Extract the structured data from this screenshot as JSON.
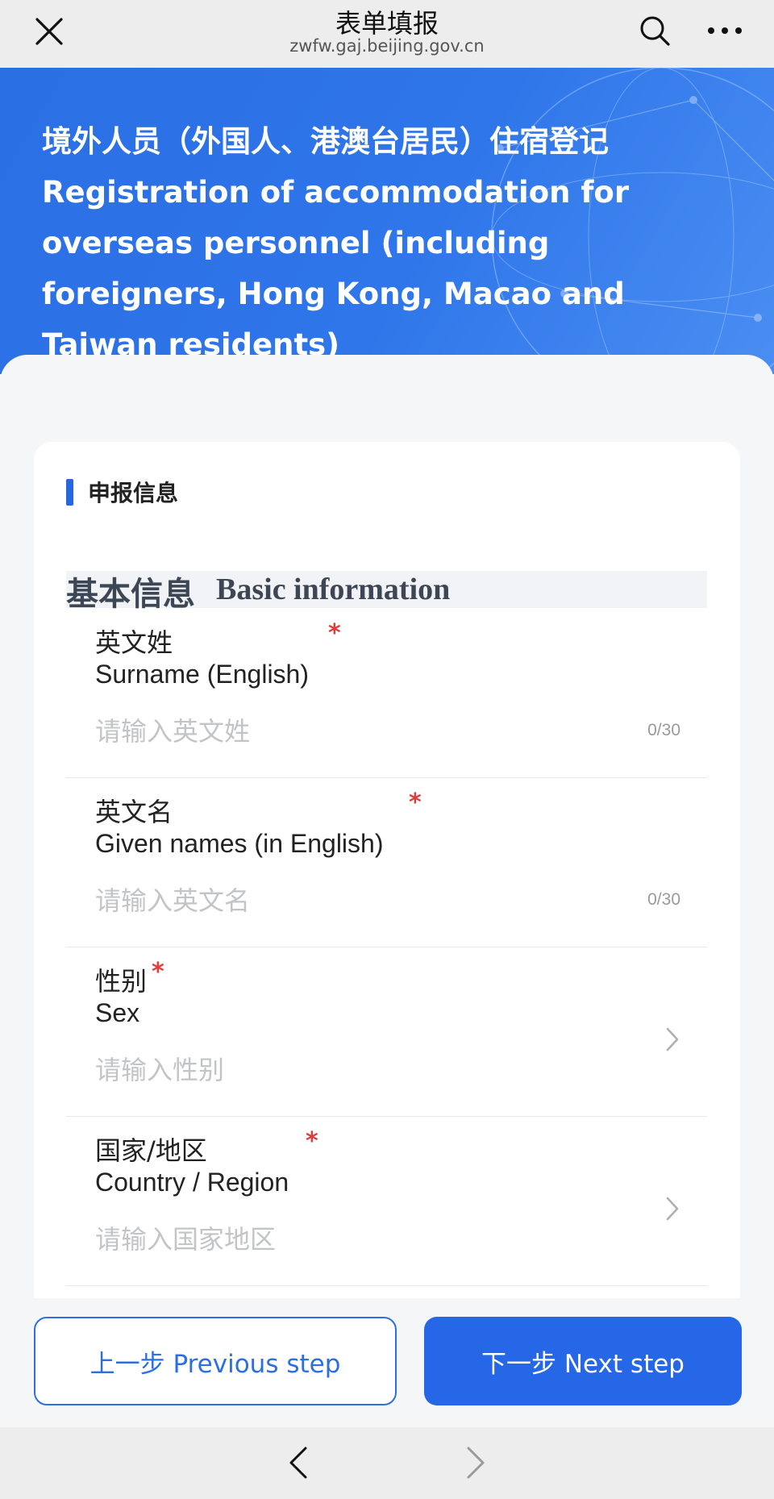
{
  "topbar": {
    "title": "表单填报",
    "url": "zwfw.gaj.beijing.gov.cn"
  },
  "banner": {
    "title": "境外人员（外国人、港澳台居民）住宿登记 Registration of accommodation for overseas personnel (including foreigners, Hong Kong, Macao and Taiwan residents)"
  },
  "section": {
    "title": "申报信息"
  },
  "group": {
    "title_zh": "基本信息",
    "title_en": "Basic information"
  },
  "fields": [
    {
      "label_zh": "英文姓",
      "label_en": "Surname (English)",
      "placeholder": "请输入英文姓",
      "counter": "0/30",
      "required_mark": "*"
    },
    {
      "label_zh": "英文名",
      "label_en": "Given names (in English)",
      "placeholder": "请输入英文名",
      "counter": "0/30",
      "required_mark": "*"
    },
    {
      "label_zh": "性别",
      "label_en": "Sex",
      "placeholder": "请输入性别",
      "required_mark": "*"
    },
    {
      "label_zh": "国家/地区",
      "label_en": "Country / Region",
      "placeholder": "请输入国家地区",
      "required_mark": "*"
    }
  ],
  "buttons": {
    "prev": "上一步 Previous step",
    "next": "下一步 Next step"
  },
  "colors": {
    "accent": "#2567e6",
    "required": "#e23b3b",
    "banner": "#2f76ea"
  },
  "icons": {
    "close": "close-icon",
    "search": "search-icon",
    "more": "more-icon",
    "chevron": "chevron-right-icon",
    "back": "nav-back-icon",
    "forward": "nav-forward-icon"
  }
}
